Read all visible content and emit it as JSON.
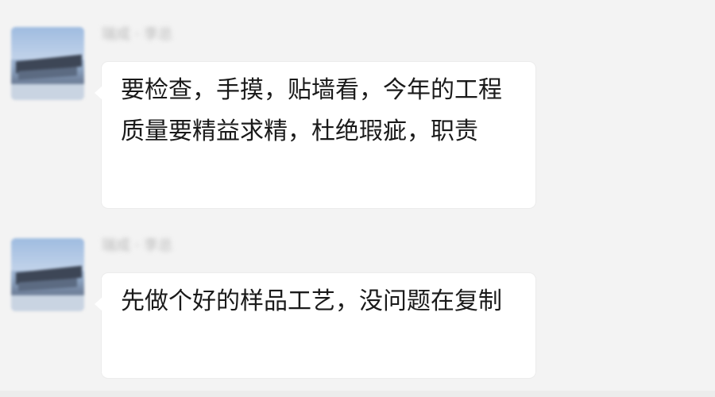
{
  "messages": [
    {
      "sender": "瑞成 · 李总",
      "text": "要检查，手摸，贴墙看，今年的工程质量要精益求精，杜绝瑕疵，职责"
    },
    {
      "sender": "瑞成 · 李总",
      "text": "先做个好的样品工艺，没问题在复制"
    }
  ],
  "colors": {
    "background": "#f3f3f3",
    "bubble": "#ffffff",
    "text": "#1a1a1a",
    "sender": "#b9b9b9"
  }
}
